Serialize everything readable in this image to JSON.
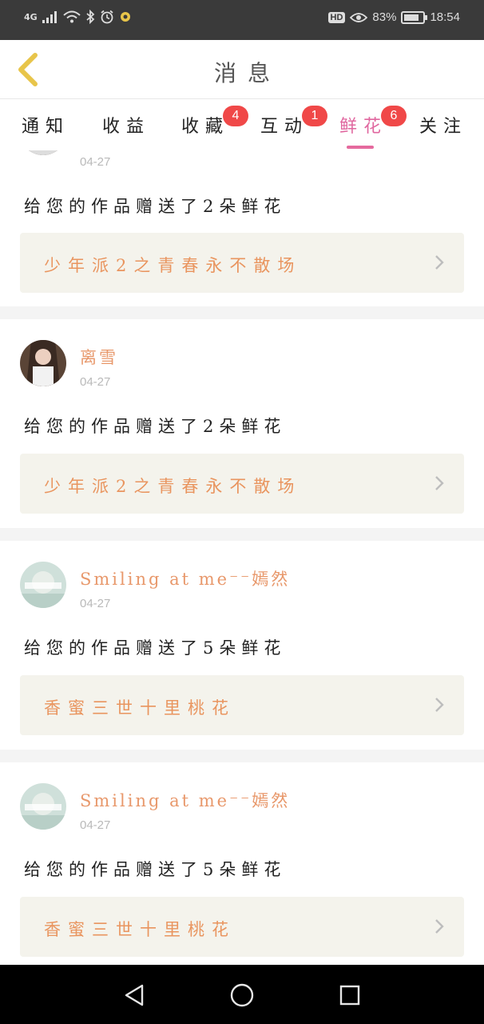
{
  "status_bar": {
    "network": "4G",
    "battery_text": "83%",
    "battery_level": 0.83,
    "time": "18:54",
    "hd": "HD"
  },
  "header": {
    "title": "消息"
  },
  "tabs": [
    {
      "label": "通知",
      "badge": null
    },
    {
      "label": "收益",
      "badge": null
    },
    {
      "label": "收藏",
      "badge": "4"
    },
    {
      "label": "互动",
      "badge": "1"
    },
    {
      "label": "鲜花",
      "badge": "6",
      "active": true
    },
    {
      "label": "关注",
      "badge": null
    }
  ],
  "messages": [
    {
      "username": "",
      "date": "04-27",
      "text": "给您的作品赠送了2朵鲜花",
      "work": "少年派2之青春永不散场"
    },
    {
      "username": "离雪",
      "date": "04-27",
      "text": "给您的作品赠送了2朵鲜花",
      "work": "少年派2之青春永不散场"
    },
    {
      "username": "Smiling at me⁻⁻嫣然",
      "date": "04-27",
      "text": "给您的作品赠送了5朵鲜花",
      "work": "香蜜三世十里桃花"
    },
    {
      "username": "Smiling at me⁻⁻嫣然",
      "date": "04-27",
      "text": "给您的作品赠送了5朵鲜花",
      "work": "香蜜三世十里桃花"
    }
  ],
  "colors": {
    "accent_pink": "#e0679f",
    "username_orange": "#e8986b",
    "work_orange": "#e9955f",
    "badge_red": "#f04848",
    "back_arrow": "#e8c54a"
  }
}
